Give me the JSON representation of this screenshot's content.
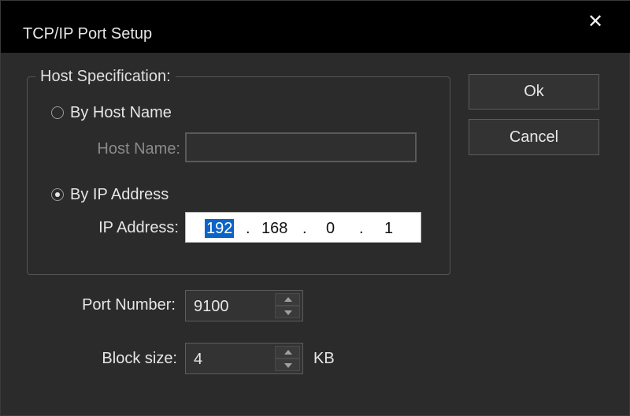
{
  "window": {
    "title": "TCP/IP Port Setup",
    "close_glyph": "✕"
  },
  "host_spec": {
    "legend": "Host Specification:",
    "by_host_name": {
      "label": "By Host Name",
      "checked": false
    },
    "host_name": {
      "label": "Host Name:",
      "value": "",
      "enabled": false
    },
    "by_ip_address": {
      "label": "By IP Address",
      "checked": true
    },
    "ip_address": {
      "label": "IP Address:",
      "octets": [
        "192",
        "168",
        "0",
        "1"
      ],
      "separator": ".",
      "selected_octet": 0
    }
  },
  "buttons": {
    "ok": "Ok",
    "cancel": "Cancel"
  },
  "port_number": {
    "label": "Port Number:",
    "value": "9100"
  },
  "block_size": {
    "label": "Block size:",
    "value": "4",
    "unit": "KB"
  },
  "colors": {
    "titlebar": "#000000",
    "dialog_bg": "#2b2b2b",
    "selection": "#0a64c8"
  }
}
